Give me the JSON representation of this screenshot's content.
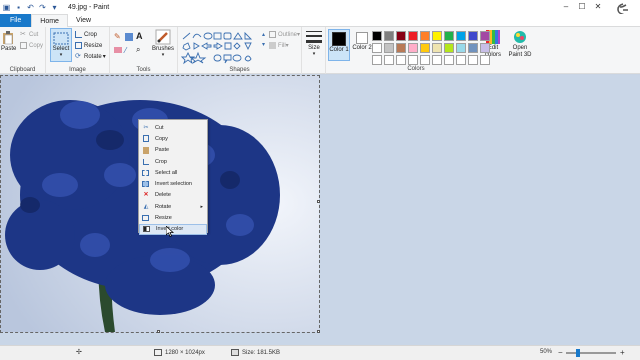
{
  "window": {
    "title": "49.jpg - Paint"
  },
  "tabs": [
    {
      "label": "File"
    },
    {
      "label": "Home"
    },
    {
      "label": "View"
    }
  ],
  "ribbon": {
    "clipboard": {
      "group_label": "Clipboard",
      "paste": "Paste",
      "cut": "Cut",
      "copy": "Copy"
    },
    "image": {
      "group_label": "Image",
      "select": "Select",
      "crop": "Crop",
      "resize": "Resize",
      "rotate": "Rotate"
    },
    "tools": {
      "group_label": "Tools",
      "brushes": "Brushes"
    },
    "shapes": {
      "group_label": "Shapes",
      "outline": "Outline",
      "fill": "Fill",
      "size": "Size"
    },
    "colors": {
      "group_label": "Colors",
      "color1": "Color 1",
      "color2": "Color 2",
      "edit_colors": "Edit colors",
      "open_paint3d": "Open Paint 3D",
      "color1_value": "#000000",
      "color2_value": "#ffffff",
      "swatches": [
        "#000000",
        "#7f7f7f",
        "#880015",
        "#ed1c24",
        "#ff7f27",
        "#fff200",
        "#22b14c",
        "#00a2e8",
        "#3f48cc",
        "#a349a4",
        "#ffffff",
        "#c3c3c3",
        "#b97a57",
        "#ffaec9",
        "#ffc90e",
        "#efe4b0",
        "#b5e61d",
        "#99d9ea",
        "#7092be",
        "#c8bfe7",
        "#ffffff",
        "#ffffff",
        "#ffffff",
        "#ffffff",
        "#ffffff",
        "#ffffff",
        "#ffffff",
        "#ffffff",
        "#ffffff",
        "#ffffff"
      ]
    }
  },
  "context_menu": [
    {
      "label": "Cut",
      "icon": "scissors-icon"
    },
    {
      "label": "Copy",
      "icon": "copy-icon"
    },
    {
      "label": "Paste",
      "icon": "paste-icon"
    },
    {
      "label": "Crop",
      "icon": "crop-icon"
    },
    {
      "label": "Select all",
      "icon": "select-all-icon"
    },
    {
      "label": "Invert selection",
      "icon": "invert-selection-icon"
    },
    {
      "label": "Delete",
      "icon": "delete-icon"
    },
    {
      "label": "Rotate",
      "icon": "rotate-icon"
    },
    {
      "label": "Resize",
      "icon": "resize-icon"
    },
    {
      "label": "Invert color",
      "icon": "invert-color-icon"
    }
  ],
  "status": {
    "dimensions": "1280 × 1024px",
    "size": "Size: 181.5KB",
    "zoom": "50%"
  }
}
